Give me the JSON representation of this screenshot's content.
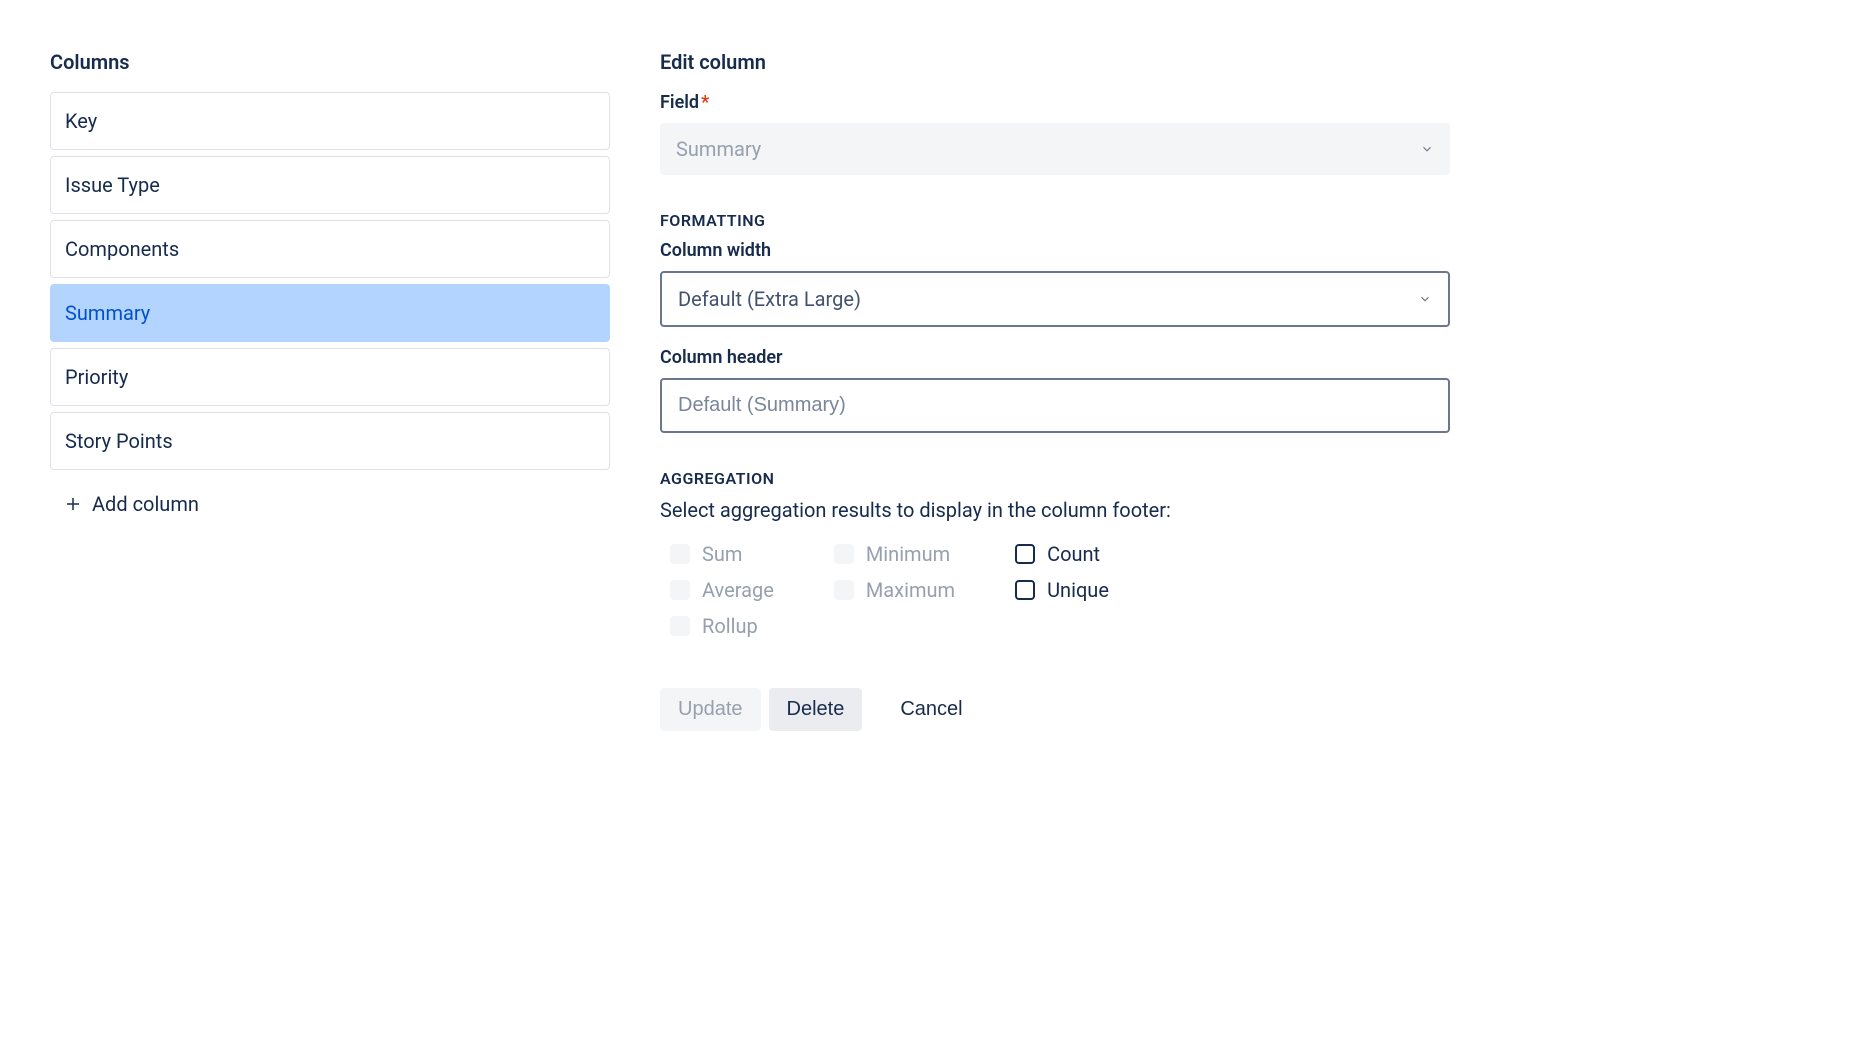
{
  "left": {
    "title": "Columns",
    "items": [
      {
        "label": "Key",
        "selected": false
      },
      {
        "label": "Issue Type",
        "selected": false
      },
      {
        "label": "Components",
        "selected": false
      },
      {
        "label": "Summary",
        "selected": true
      },
      {
        "label": "Priority",
        "selected": false
      },
      {
        "label": "Story Points",
        "selected": false
      }
    ],
    "add_label": "Add column"
  },
  "right": {
    "title": "Edit column",
    "field_label": "Field",
    "field_value": "Summary",
    "formatting_title": "FORMATTING",
    "width_label": "Column width",
    "width_value": "Default (Extra Large)",
    "header_label": "Column header",
    "header_placeholder": "Default (Summary)",
    "aggregation_title": "AGGREGATION",
    "aggregation_help": "Select aggregation results to display in the column footer:",
    "checks": {
      "sum": "Sum",
      "average": "Average",
      "rollup": "Rollup",
      "minimum": "Minimum",
      "maximum": "Maximum",
      "count": "Count",
      "unique": "Unique"
    },
    "buttons": {
      "update": "Update",
      "delete": "Delete",
      "cancel": "Cancel"
    }
  }
}
